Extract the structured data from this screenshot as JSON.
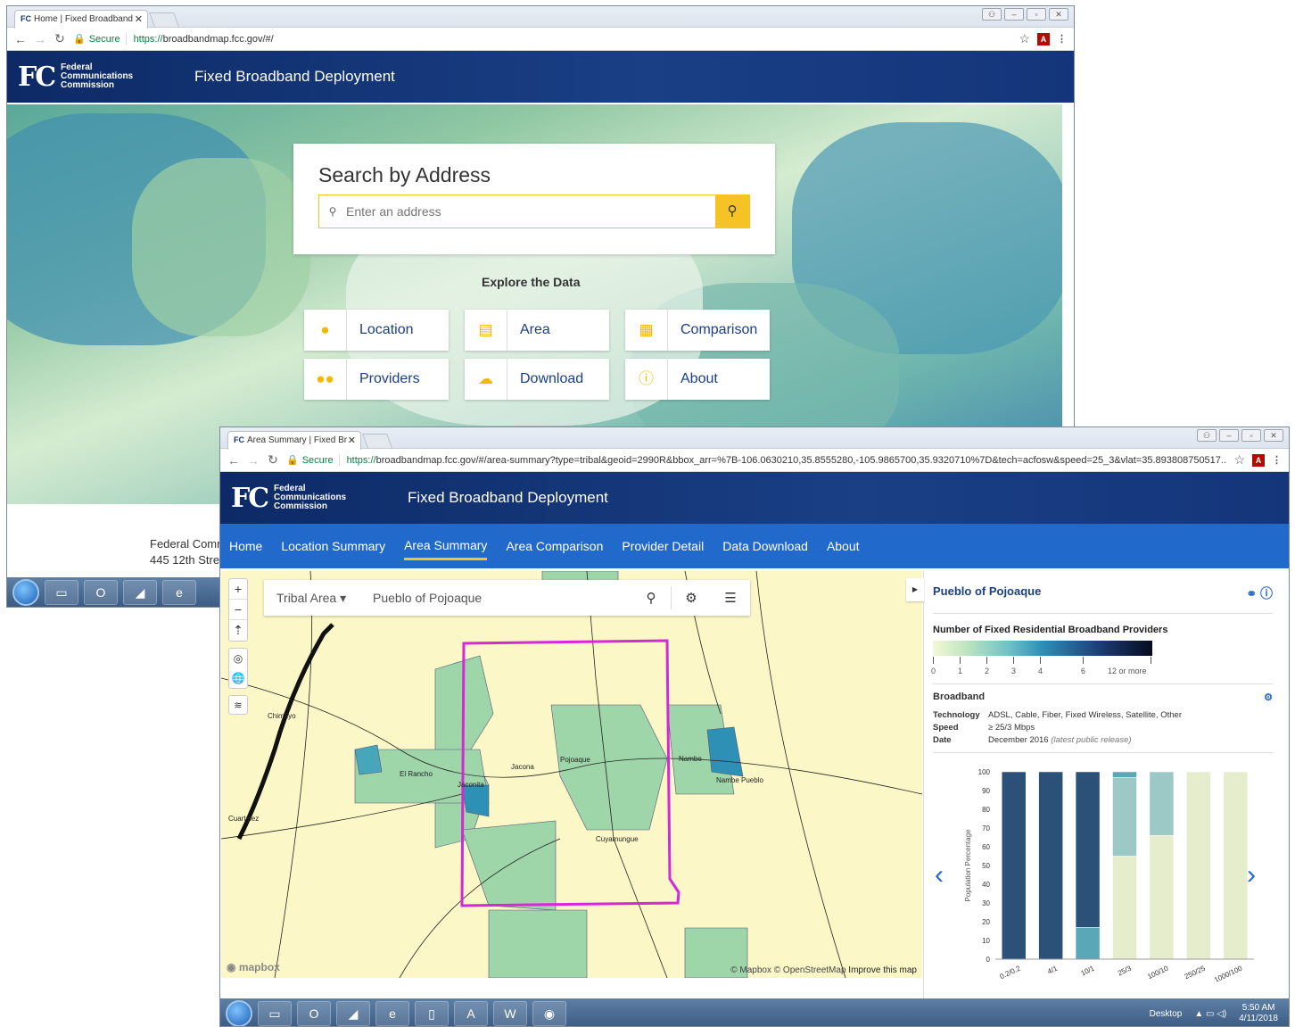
{
  "w1": {
    "tab_title": "Home | Fixed Broadband",
    "url_scheme": "https://",
    "url_rest": "broadbandmap.fcc.gov/#/",
    "secure": "Secure",
    "fcc_name": [
      "Federal",
      "Communications",
      "Commission"
    ],
    "site_title": "Fixed Broadband Deployment",
    "search_heading": "Search by Address",
    "search_placeholder": "Enter an address",
    "explore": "Explore the Data",
    "buttons": [
      {
        "label": "Location",
        "icon": "map-pin-icon"
      },
      {
        "label": "Area",
        "icon": "map-icon"
      },
      {
        "label": "Comparison",
        "icon": "table-icon"
      },
      {
        "label": "Providers",
        "icon": "users-icon"
      },
      {
        "label": "Download",
        "icon": "cloud-download-icon"
      },
      {
        "label": "About",
        "icon": "info-icon"
      }
    ],
    "footer": [
      "Federal Comm",
      "445 12th Stre"
    ]
  },
  "w2": {
    "tab_title": "Area Summary | Fixed Br",
    "secure": "Secure",
    "url_scheme": "https://",
    "url_rest": "broadbandmap.fcc.gov/#/area-summary?type=tribal&geoid=2990R&bbox_arr=%7B-106.0630210,35.8555280,-105.9865700,35.9320710%7D&tech=acfosw&speed=25_3&vlat=35.893808750517...",
    "fcc_name": [
      "Federal",
      "Communications",
      "Commission"
    ],
    "site_title": "Fixed Broadband Deployment",
    "nav": [
      "Home",
      "Location Summary",
      "Area Summary",
      "Area Comparison",
      "Provider Detail",
      "Data Download",
      "About"
    ],
    "nav_active": 2,
    "map_type": "Tribal Area",
    "map_name": "Pueblo of Pojoaque",
    "attribution": "© Mapbox © OpenStreetMap",
    "improve": "Improve this map",
    "mapbox": "mapbox",
    "place_labels": [
      "Pojoaque",
      "Jacona",
      "El Rancho",
      "Jaconita",
      "Nambe",
      "Nambe Pueblo",
      "Cuyamungue",
      "Chimayo",
      "Cuartelez"
    ],
    "panel_title": "Pueblo of Pojoaque",
    "legend_title": "Number of Fixed Residential Broadband Providers",
    "legend_labels": [
      "0",
      "1",
      "2",
      "3",
      "4",
      "6",
      "12 or more"
    ],
    "bb_title": "Broadband",
    "tech_k": "Technology",
    "tech_v": "ADSL, Cable, Fiber, Fixed Wireless, Satellite, Other",
    "speed_k": "Speed",
    "speed_v": "≥ 25/3 Mbps",
    "date_k": "Date",
    "date_v": "December 2016",
    "date_note": "(latest public release)"
  },
  "chart_data": {
    "type": "bar",
    "stacked": true,
    "ylabel": "Population Percentage",
    "ylim": [
      0,
      100
    ],
    "yticks": [
      0,
      10,
      20,
      30,
      40,
      50,
      60,
      70,
      80,
      90,
      100
    ],
    "categories": [
      "0.2/0.2",
      "4/1",
      "10/1",
      "25/3",
      "100/10",
      "250/25",
      "1000/100"
    ],
    "series": [
      {
        "color": "#e6edcd",
        "values": [
          0,
          0,
          0,
          55,
          66,
          100,
          100
        ]
      },
      {
        "color": "#9cc9c6",
        "values": [
          0,
          0,
          0,
          42,
          34,
          0,
          0
        ]
      },
      {
        "color": "#5aa7b8",
        "values": [
          0,
          0,
          17,
          3,
          0,
          0,
          0
        ]
      },
      {
        "color": "#2c5178",
        "values": [
          100,
          100,
          83,
          0,
          0,
          0,
          0
        ]
      }
    ]
  },
  "taskbar": {
    "desktop": "Desktop",
    "time": "5:50 AM",
    "date": "4/11/2018"
  }
}
